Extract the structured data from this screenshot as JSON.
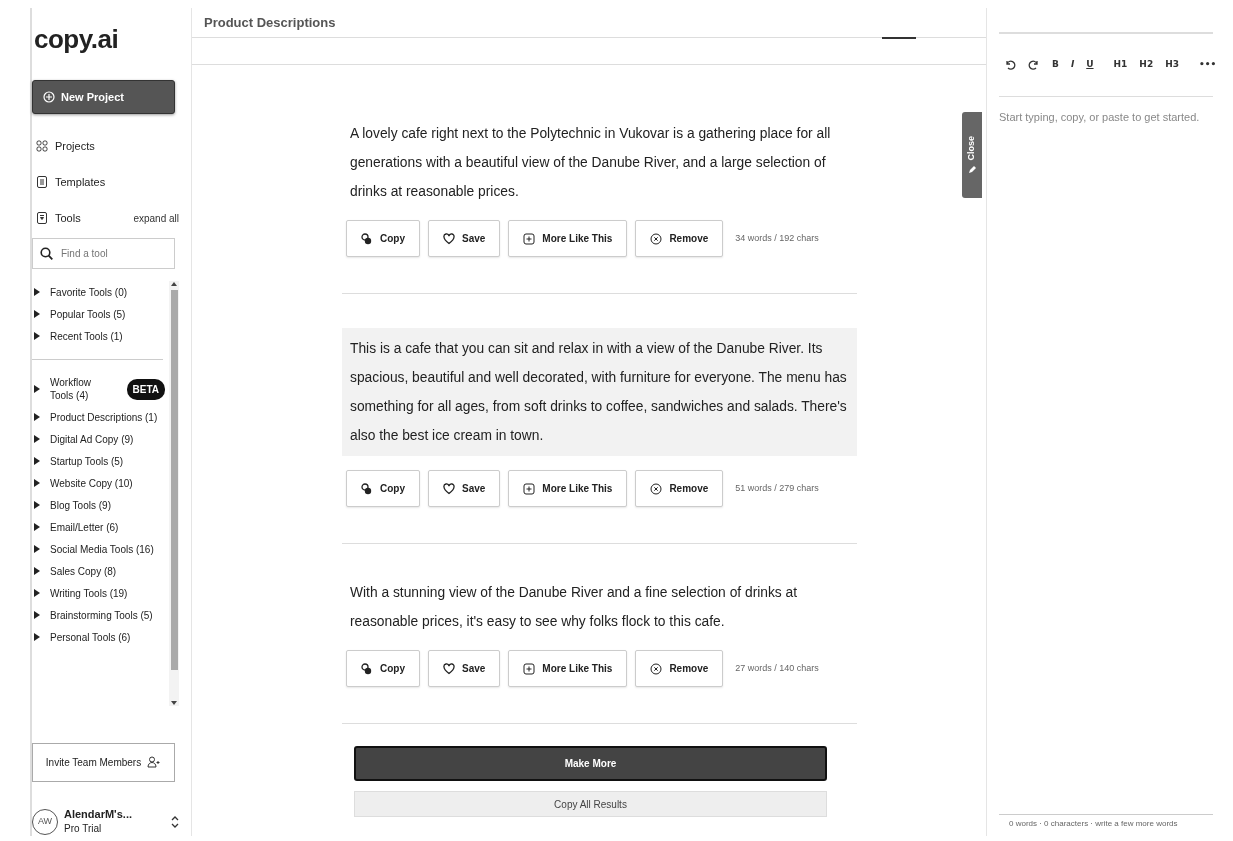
{
  "sidebar": {
    "logo": "copy.ai",
    "new_project": "New Project",
    "nav": [
      {
        "kind": "projects",
        "label": "Projects"
      },
      {
        "kind": "templates",
        "label": "Templates"
      },
      {
        "kind": "tools",
        "label": "Tools",
        "action": "expand all"
      }
    ],
    "search": {
      "placeholder": "Find a tool"
    },
    "tool_groups": [
      {
        "label": "Favorite Tools (0)"
      },
      {
        "label": "Popular Tools (5)"
      },
      {
        "label": "Recent Tools (1)"
      }
    ],
    "workflow_groups": [
      {
        "label": "Workflow Tools (4)",
        "badge": "BETA"
      },
      {
        "label": "Product Descriptions (1)"
      },
      {
        "label": "Digital Ad Copy (9)"
      },
      {
        "label": "Startup Tools (5)"
      },
      {
        "label": "Website Copy (10)"
      },
      {
        "label": "Blog Tools (9)"
      },
      {
        "label": "Email/Letter (6)"
      },
      {
        "label": "Social Media Tools (16)"
      },
      {
        "label": "Sales Copy (8)"
      },
      {
        "label": "Writing Tools (19)"
      },
      {
        "label": "Brainstorming Tools (5)"
      },
      {
        "label": "Personal Tools (6)"
      }
    ],
    "invite": "Invite Team Members",
    "account": {
      "initials": "AW",
      "name": "AlendarM's...",
      "plan": "Pro Trial"
    }
  },
  "main": {
    "title": "Product Descriptions",
    "results": [
      {
        "text": "A lovely cafe right next to the Polytechnic in Vukovar is a gathering place for all generations with a beautiful view of the Danube River, and a large selection of drinks at reasonable prices.",
        "highlighted": false,
        "stats": "34 words / 192 chars",
        "buttons": [
          {
            "kind": "copy",
            "label": "Copy"
          },
          {
            "kind": "save",
            "label": "Save"
          },
          {
            "kind": "more",
            "label": "More Like This"
          },
          {
            "kind": "remove",
            "label": "Remove"
          }
        ]
      },
      {
        "text": "This is a cafe that you can sit and relax in with a view of the Danube River. Its spacious, beautiful and well decorated, with furniture for everyone. The menu has something for all ages, from soft drinks to coffee, sandwiches and salads. There's also the best ice cream in town.",
        "highlighted": true,
        "stats": "51 words / 279 chars",
        "buttons": [
          {
            "kind": "copy",
            "label": "Copy"
          },
          {
            "kind": "save",
            "label": "Save"
          },
          {
            "kind": "more",
            "label": "More Like This"
          },
          {
            "kind": "remove",
            "label": "Remove"
          }
        ]
      },
      {
        "text": "With a stunning view of the Danube River and a fine selection of drinks at reasonable prices, it's easy to see why folks flock to this cafe.",
        "highlighted": false,
        "stats": "27 words / 140 chars",
        "buttons": [
          {
            "kind": "copy",
            "label": "Copy"
          },
          {
            "kind": "save",
            "label": "Save"
          },
          {
            "kind": "more",
            "label": "More Like This"
          },
          {
            "kind": "remove",
            "label": "Remove"
          }
        ]
      }
    ],
    "make_more": "Make More",
    "copy_all": "Copy All Results"
  },
  "close_tab": "Close",
  "editor": {
    "toolbar": [
      {
        "kind": "undo"
      },
      {
        "kind": "redo"
      },
      {
        "kind": "bold",
        "label": "B"
      },
      {
        "kind": "italic",
        "label": "I"
      },
      {
        "kind": "underline",
        "label": "U"
      },
      {
        "kind": "separator"
      },
      {
        "kind": "heading",
        "label": "H1"
      },
      {
        "kind": "heading",
        "label": "H2"
      },
      {
        "kind": "heading",
        "label": "H3"
      },
      {
        "kind": "separator"
      },
      {
        "kind": "menu",
        "label": "•••"
      }
    ],
    "placeholder": "Start typing, copy, or paste to get started.",
    "status": "0 words · 0 characters · write a few more words"
  }
}
